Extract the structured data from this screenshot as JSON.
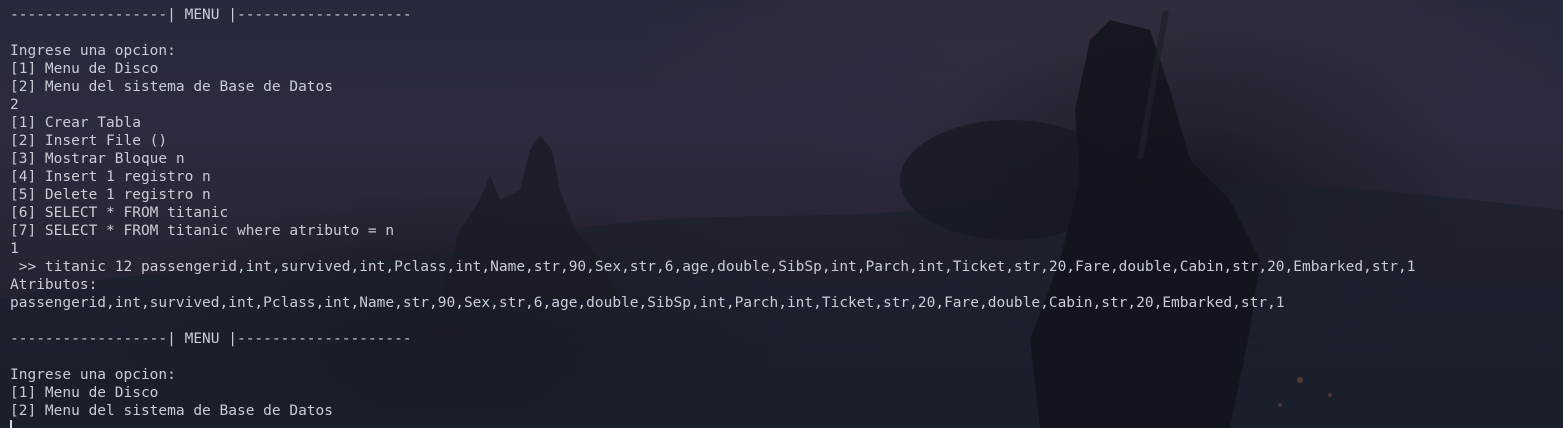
{
  "terminal": {
    "lines": [
      "------------------| MENU |--------------------",
      "",
      "Ingrese una opcion:",
      "[1] Menu de Disco",
      "[2] Menu del sistema de Base de Datos",
      "2",
      "[1] Crear Tabla",
      "[2] Insert File ()",
      "[3] Mostrar Bloque n",
      "[4] Insert 1 registro n",
      "[5] Delete 1 registro n",
      "[6] SELECT * FROM titanic",
      "[7] SELECT * FROM titanic where atributo = n",
      "1",
      " >> titanic 12 passengerid,int,survived,int,Pclass,int,Name,str,90,Sex,str,6,age,double,SibSp,int,Parch,int,Ticket,str,20,Fare,double,Cabin,str,20,Embarked,str,1",
      "Atributos:",
      "passengerid,int,survived,int,Pclass,int,Name,str,90,Sex,str,6,age,double,SibSp,int,Parch,int,Ticket,str,20,Fare,double,Cabin,str,20,Embarked,str,1",
      "",
      "------------------| MENU |--------------------",
      "",
      "Ingrese una opcion:",
      "[1] Menu de Disco",
      "[2] Menu del sistema de Base de Datos"
    ]
  },
  "colors": {
    "text": "#c9ccd6",
    "background": "#1c2230",
    "cursor": "#d8dbe4"
  }
}
